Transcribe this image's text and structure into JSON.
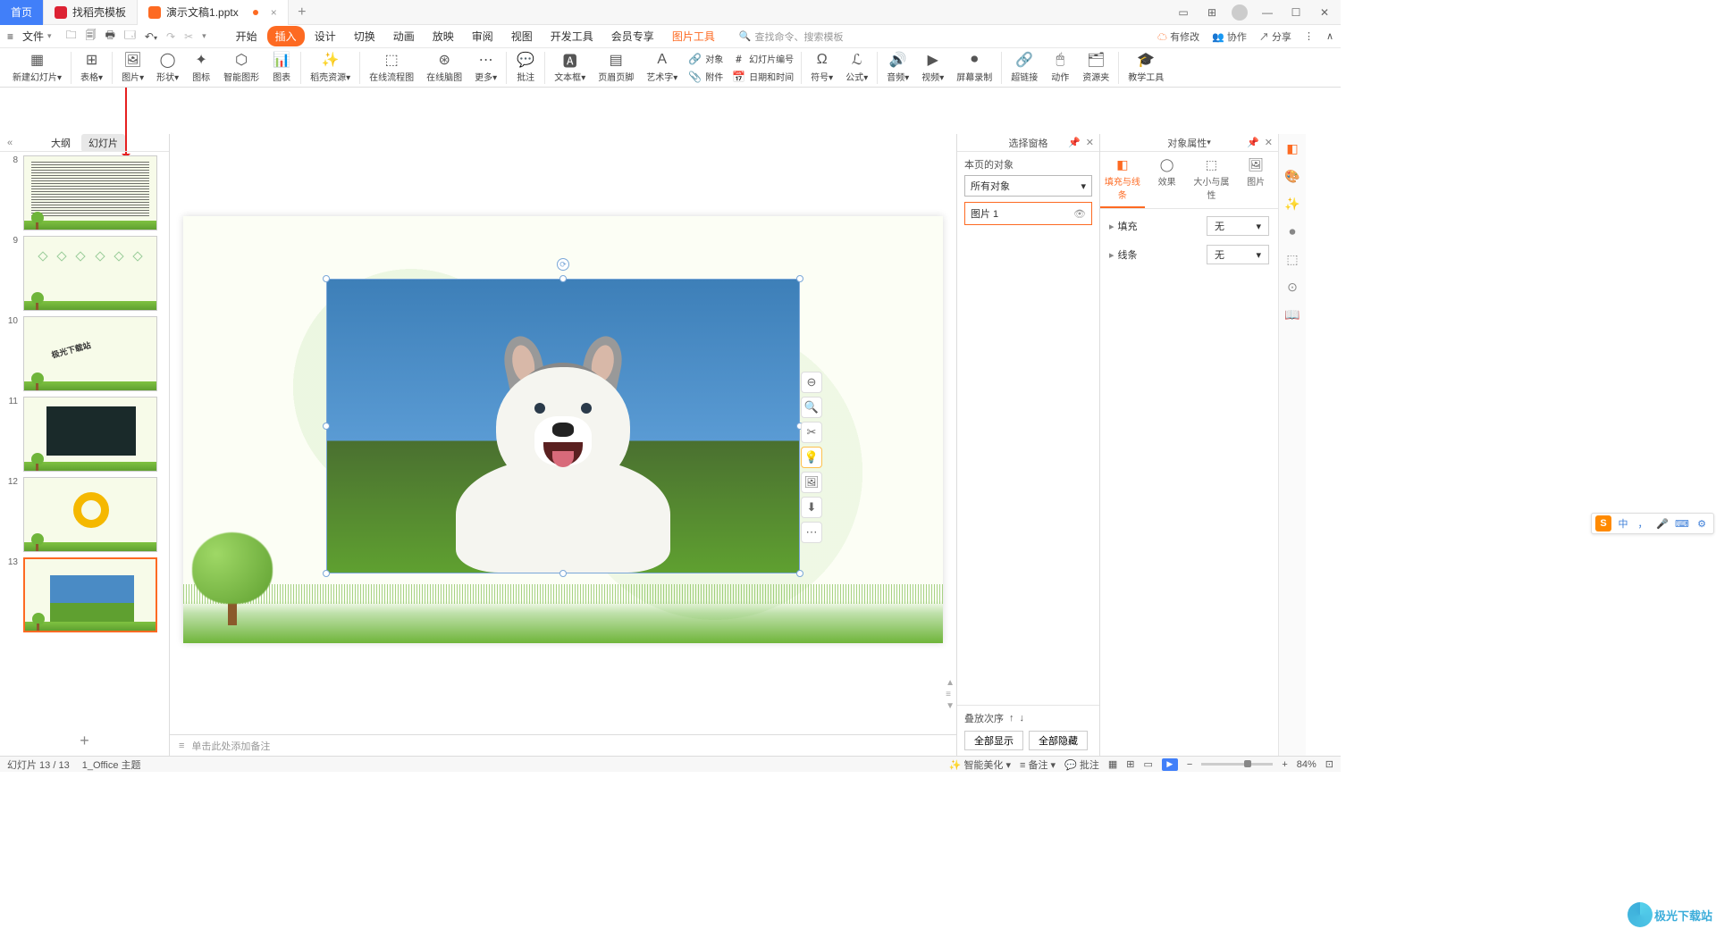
{
  "titlebar": {
    "tabs": [
      {
        "label": "首页"
      },
      {
        "label": "找稻壳模板"
      },
      {
        "label": "演示文稿1.pptx"
      }
    ],
    "add": "+"
  },
  "menubar": {
    "file": "文件",
    "tabs": {
      "start": "开始",
      "insert": "插入",
      "design": "设计",
      "transition": "切换",
      "animation": "动画",
      "slideshow": "放映",
      "review": "审阅",
      "view": "视图",
      "dev": "开发工具",
      "member": "会员专享",
      "pictool": "图片工具"
    },
    "search_placeholder": "查找命令、搜索模板",
    "right": {
      "pending": "有修改",
      "collab": "协作",
      "share": "分享"
    }
  },
  "ribbon": {
    "new_slide": "新建幻灯片",
    "table": "表格",
    "picture": "图片",
    "shape": "形状",
    "icon": "图标",
    "smart": "智能图形",
    "chart": "图表",
    "resource": "稻壳资源",
    "flow": "在线流程图",
    "mind": "在线脑图",
    "more": "更多",
    "comment": "批注",
    "textbox": "文本框",
    "header": "页眉页脚",
    "wordart": "艺术字",
    "object": "对象",
    "slide_num": "幻灯片编号",
    "attach": "附件",
    "datetime": "日期和时间",
    "symbol": "符号",
    "formula": "公式",
    "audio": "音频",
    "video": "视频",
    "record": "屏幕录制",
    "hyperlink": "超链接",
    "action": "动作",
    "res_folder": "资源夹",
    "teach": "教学工具"
  },
  "slide_panel": {
    "outline": "大纲",
    "slides": "幻灯片",
    "thumbs": [
      {
        "num": "8"
      },
      {
        "num": "9"
      },
      {
        "num": "10"
      },
      {
        "num": "11"
      },
      {
        "num": "12"
      },
      {
        "num": "13"
      }
    ]
  },
  "notes": {
    "placeholder": "单击此处添加备注"
  },
  "selection_pane": {
    "title": "选择窗格",
    "objects_label": "本页的对象",
    "all_objects": "所有对象",
    "item1": "图片 1",
    "stack_label": "叠放次序",
    "show_all": "全部显示",
    "hide_all": "全部隐藏"
  },
  "props": {
    "title": "对象属性",
    "tabs": {
      "fill": "填充与线条",
      "effect": "效果",
      "size": "大小与属性",
      "pic": "图片"
    },
    "fill_label": "填充",
    "line_label": "线条",
    "none": "无"
  },
  "ime": {
    "lang": "中",
    "punct": "，",
    "mic": "🎤",
    "kbd": "⌨",
    "grid": "⚙"
  },
  "statusbar": {
    "slide_pos": "幻灯片 13 / 13",
    "theme": "1_Office 主题",
    "beautify": "智能美化",
    "notes": "备注",
    "comments": "批注",
    "zoom": "84%"
  },
  "watermark": "极光下载站"
}
